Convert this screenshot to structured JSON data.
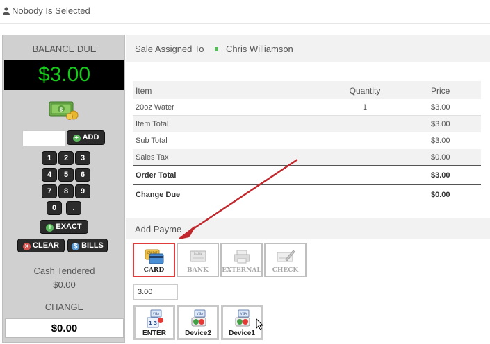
{
  "header": {
    "selection_status": "Nobody Is Selected"
  },
  "balance": {
    "label": "BALANCE DUE",
    "amount": "$3.00",
    "add_label": "ADD",
    "keypad": [
      "1",
      "2",
      "3",
      "4",
      "5",
      "6",
      "7",
      "8",
      "9",
      "0",
      "."
    ],
    "exact_label": "EXACT",
    "clear_label": "CLEAR",
    "bills_label": "BILLS",
    "cash_tendered_label": "Cash Tendered",
    "cash_tendered_value": "$0.00",
    "change_label": "CHANGE",
    "change_value": "$0.00",
    "colors": {
      "amount_text": "#18c91c",
      "amount_bg": "#000000"
    }
  },
  "sale": {
    "assigned_label": "Sale Assigned To",
    "assigned_name": "Chris Williamson"
  },
  "table": {
    "headers": [
      "Item",
      "Quantity",
      "Price"
    ],
    "rows": [
      {
        "item": "20oz Water",
        "quantity": "1",
        "price": "$3.00"
      }
    ],
    "summary": [
      {
        "label": "Item Total",
        "value": "$3.00"
      },
      {
        "label": "Sub Total",
        "value": "$3.00"
      },
      {
        "label": "Sales Tax",
        "value": "$0.00"
      },
      {
        "label": "Order Total",
        "value": "$3.00"
      },
      {
        "label": "Change Due",
        "value": "$0.00"
      }
    ]
  },
  "payment": {
    "section_label": "Add Payme",
    "methods": [
      {
        "label": "CARD",
        "icon": "credit-card-icon",
        "selected": true
      },
      {
        "label": "BANK",
        "icon": "bank-icon",
        "selected": false
      },
      {
        "label": "EXTERNAL",
        "icon": "external-terminal-icon",
        "selected": false
      },
      {
        "label": "CHECK",
        "icon": "check-icon",
        "selected": false
      }
    ],
    "amount_value": "3.00",
    "devices": [
      {
        "label": "ENTER",
        "icon": "card-keypad-icon"
      },
      {
        "label": "Device2",
        "icon": "card-device-icon"
      },
      {
        "label": "Device1",
        "icon": "card-device-icon"
      }
    ],
    "colors": {
      "selected_border": "#e03c3c",
      "annotation_arrow": "#c0282d"
    }
  }
}
